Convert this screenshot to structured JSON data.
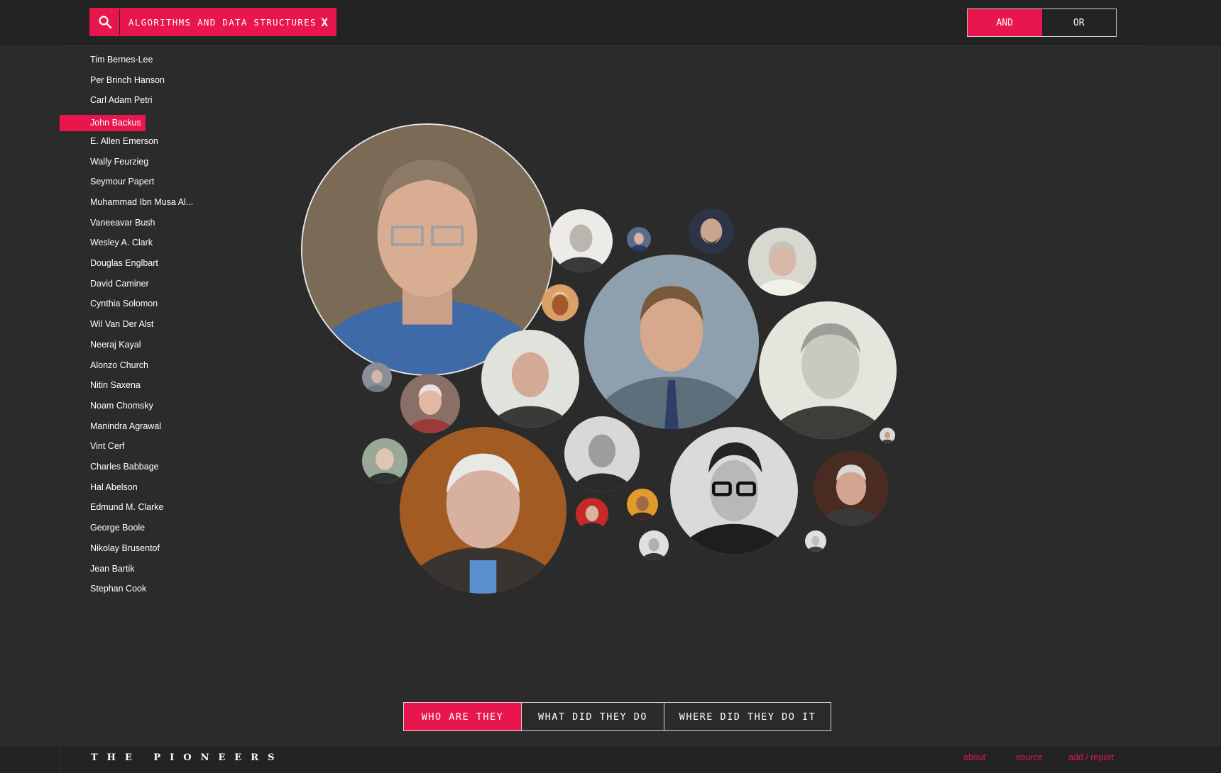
{
  "search": {
    "active_term": "ALGORITHMS AND DATA STRUCTURES",
    "clear_label": "X",
    "icon": "search-icon"
  },
  "logic_toggle": {
    "options": [
      {
        "label": "AND",
        "active": true
      },
      {
        "label": "OR",
        "active": false
      }
    ]
  },
  "pioneers": [
    {
      "name": "Tim Bernes-Lee"
    },
    {
      "name": "Per Brinch Hanson"
    },
    {
      "name": "Carl Adam Petri"
    },
    {
      "name": "John Backus",
      "selected": true
    },
    {
      "name": "E. Allen Emerson"
    },
    {
      "name": "Wally Feurzieg"
    },
    {
      "name": "Seymour Papert"
    },
    {
      "name": "Muhammad Ibn Musa Al..."
    },
    {
      "name": "Vaneeavar Bush"
    },
    {
      "name": "Wesley A. Clark"
    },
    {
      "name": "Douglas Englbart"
    },
    {
      "name": "David Caminer"
    },
    {
      "name": "Cynthia Solomon"
    },
    {
      "name": "Wil Van Der Alst"
    },
    {
      "name": "Neeraj Kayal"
    },
    {
      "name": "Alonzo Church"
    },
    {
      "name": "Nitin Saxena"
    },
    {
      "name": "Noam Chomsky"
    },
    {
      "name": "Manindra Agrawal"
    },
    {
      "name": "Vint Cerf"
    },
    {
      "name": "Charles Babbage"
    },
    {
      "name": "Hal Abelson"
    },
    {
      "name": "Edmund M. Clarke"
    },
    {
      "name": "George Boole"
    },
    {
      "name": "Nikolay Brusentof"
    },
    {
      "name": "Jean Bartik"
    },
    {
      "name": "Stephan Cook"
    }
  ],
  "view_tabs": [
    {
      "label": "WHO ARE THEY",
      "active": true
    },
    {
      "label": "WHAT DID THEY DO",
      "active": false
    },
    {
      "label": "WHERE DID THEY DO IT",
      "active": false
    }
  ],
  "footer": {
    "brand": "THE PIONEERS",
    "links": [
      "about",
      "source",
      "add / report"
    ]
  },
  "colors": {
    "accent": "#e8164c",
    "background": "#2b2b2c",
    "bar": "#232324"
  }
}
